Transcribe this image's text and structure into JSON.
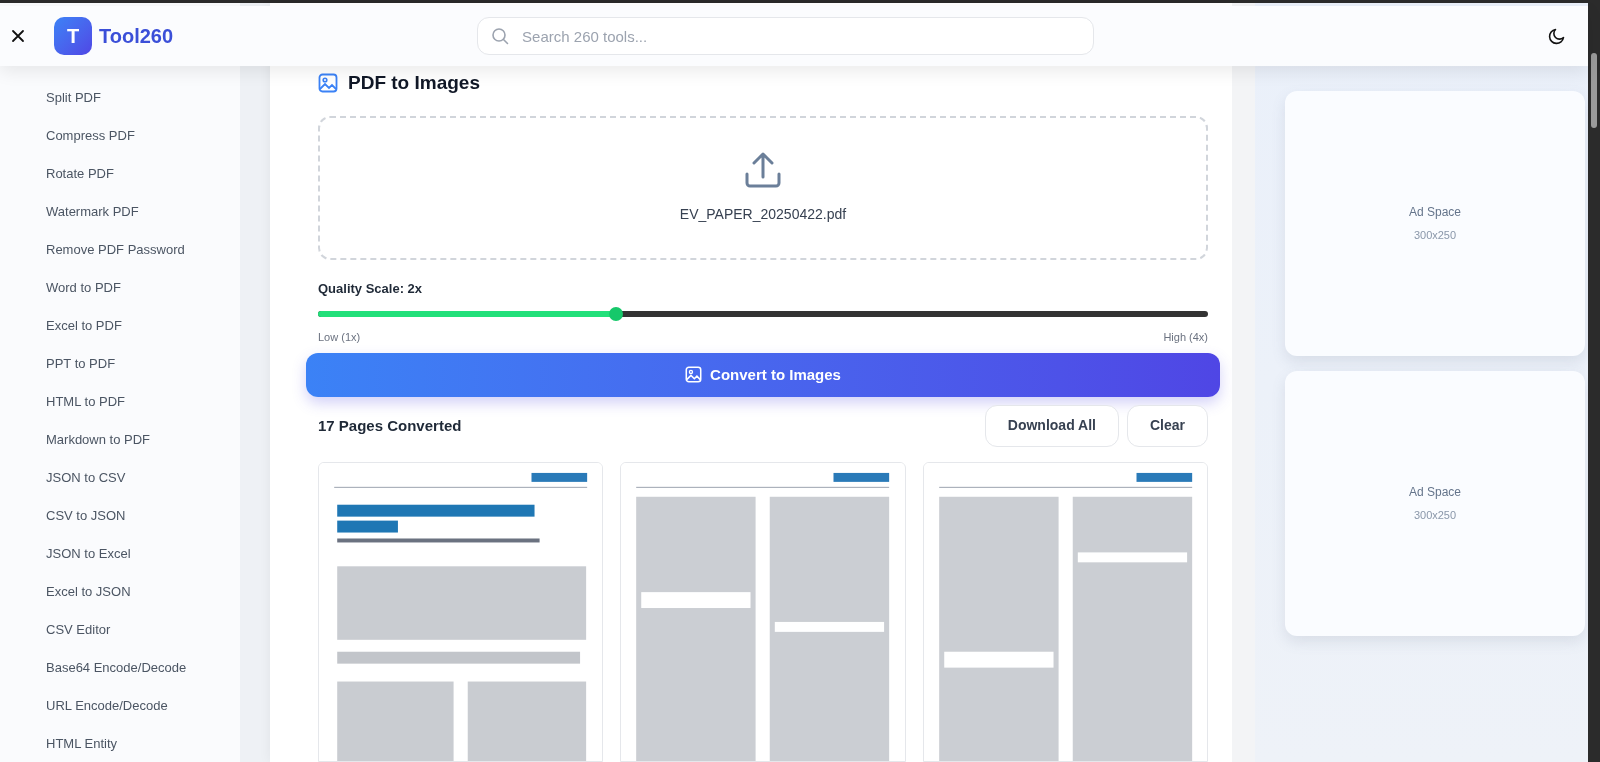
{
  "header": {
    "logo_letter": "T",
    "brand": "Tool260",
    "search": {
      "placeholder": "Search 260 tools..."
    }
  },
  "sidebar": {
    "items": [
      "Split PDF",
      "Compress PDF",
      "Rotate PDF",
      "Watermark PDF",
      "Remove PDF Password",
      "Word to PDF",
      "Excel to PDF",
      "PPT to PDF",
      "HTML to PDF",
      "Markdown to PDF",
      "JSON to CSV",
      "CSV to JSON",
      "JSON to Excel",
      "Excel to JSON",
      "CSV Editor",
      "Base64 Encode/Decode",
      "URL Encode/Decode",
      "HTML Entity"
    ]
  },
  "tool": {
    "title": "PDF to Images",
    "upload": {
      "file_name": "EV_PAPER_20250422.pdf"
    },
    "quality": {
      "label": "Quality Scale: 2x",
      "level": 0.335,
      "min_label": "Low (1x)",
      "max_label": "High (4x)"
    },
    "convert_button": "Convert to Images",
    "results": {
      "count_label": "17 Pages Converted",
      "buttons": [
        "Download All",
        "Clear"
      ],
      "pages": [
        {
          "kind": "picture"
        },
        {
          "kind": "picture"
        },
        {
          "kind": "picture"
        }
      ]
    }
  },
  "ads": [
    {
      "title": "Ad Space",
      "size": "300x250"
    },
    {
      "title": "Ad Space",
      "size": "300x250"
    }
  ]
}
